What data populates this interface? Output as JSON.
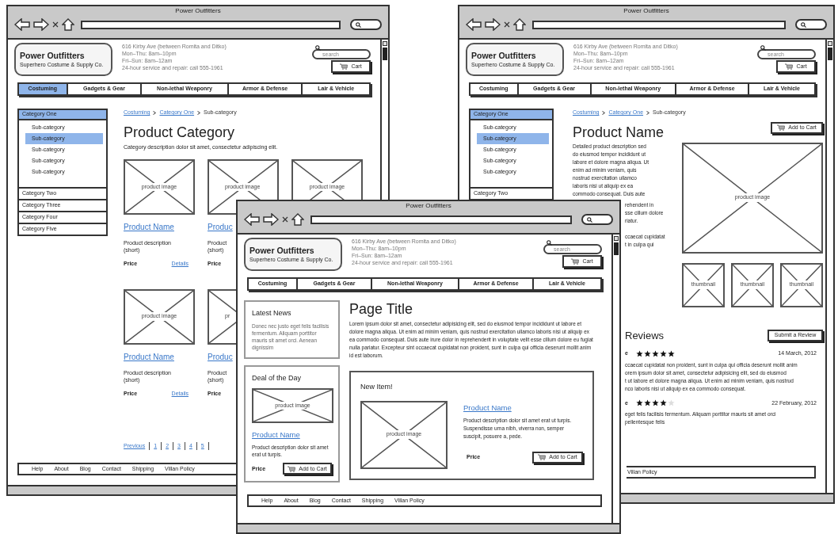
{
  "windows": [
    {
      "kind": "category",
      "title": "Power Outfitters",
      "header": {
        "logo_title": "Power Outfitters",
        "logo_subtitle": "Superhero Costume & Supply Co.",
        "address_lines": [
          "616 Kirby Ave (between Romita and Ditko)",
          "Mon–Thu: 8am–10pm",
          "Fri–Sun: 8am–12am",
          "24-hour service and repair: call 555-1961"
        ],
        "search_placeholder": "search",
        "cart": "Cart"
      },
      "nav": [
        {
          "label": "Costuming",
          "selected": true
        },
        {
          "label": "Gadgets & Gear",
          "selected": false
        },
        {
          "label": "Non-lethal Weaponry",
          "selected": false
        },
        {
          "label": "Armor & Defense",
          "selected": false
        },
        {
          "label": "Lair & Vehicle",
          "selected": false
        }
      ],
      "sidebar": [
        {
          "label": "Category One",
          "selected": true,
          "children": [
            {
              "label": "Sub-category",
              "selected": false
            },
            {
              "label": "Sub-category",
              "selected": true
            },
            {
              "label": "Sub-category",
              "selected": false
            },
            {
              "label": "Sub-category",
              "selected": false
            },
            {
              "label": "Sub-category",
              "selected": false
            }
          ]
        },
        {
          "label": "Category Two",
          "selected": false
        },
        {
          "label": "Category Three",
          "selected": false
        },
        {
          "label": "Category Four",
          "selected": false
        },
        {
          "label": "Category Five",
          "selected": false
        }
      ],
      "breadcrumb": [
        {
          "label": "Costuming",
          "link": true
        },
        {
          "label": "Category One",
          "link": true
        },
        {
          "label": "Sub-category",
          "link": false
        }
      ],
      "heading": "Product Category",
      "description": "Category description dolor sit amet, consectetur adipiscing elit.",
      "product_rows": [
        [
          {
            "kind": "full",
            "image_label": "product image",
            "name": "Product Name",
            "description_lines": [
              "Product description",
              "(short)"
            ],
            "price": "Price",
            "details": "Details"
          },
          {
            "kind": "cut",
            "image_label": "product image",
            "name": "Produc",
            "description_lines": [
              "Product",
              "(short)"
            ],
            "price": "Price"
          },
          {
            "kind": "full",
            "image_label": "product image"
          }
        ],
        [
          {
            "kind": "full",
            "image_label": "product image",
            "name": "Product Name",
            "description_lines": [
              "Product description",
              "(short)"
            ],
            "price": "Price",
            "details": "Details"
          },
          {
            "kind": "cut",
            "image_label": "pr",
            "name": "Produc",
            "description_lines": [
              "Product",
              "(short)"
            ],
            "price": "Price"
          }
        ]
      ],
      "pagination": {
        "previous": "Previous",
        "pages": [
          "1",
          "2",
          "3",
          "4",
          "5"
        ]
      },
      "footer": [
        "Help",
        "About",
        "Blog",
        "Contact",
        "Shipping",
        "Villan Policy"
      ]
    },
    {
      "kind": "product",
      "title": "Power Outfitters",
      "header": {
        "logo_title": "Power Outfitters",
        "logo_subtitle": "Superhero Costume & Supply Co.",
        "address_lines": [
          "616 Kirby Ave (between Romita and Ditko)",
          "Mon–Thu: 8am–10pm",
          "Fri–Sun: 8am–12am",
          "24-hour service and repair: call 555-1961"
        ],
        "search_placeholder": "search",
        "cart": "Cart"
      },
      "nav": [
        {
          "label": "Costuming",
          "selected": false
        },
        {
          "label": "Gadgets & Gear",
          "selected": false
        },
        {
          "label": "Non-lethal Weaponry",
          "selected": false
        },
        {
          "label": "Armor & Defense",
          "selected": false
        },
        {
          "label": "Lair & Vehicle",
          "selected": false
        }
      ],
      "sidebar": [
        {
          "label": "Category One",
          "selected": true,
          "children": [
            {
              "label": "Sub-category",
              "selected": false
            },
            {
              "label": "Sub-category",
              "selected": true
            },
            {
              "label": "Sub-category",
              "selected": false
            },
            {
              "label": "Sub-category",
              "selected": false
            },
            {
              "label": "Sub-category",
              "selected": false
            }
          ]
        },
        {
          "label": "Category Two",
          "selected": false
        }
      ],
      "breadcrumb": [
        {
          "label": "Costuming",
          "link": true
        },
        {
          "label": "Category One",
          "link": true
        },
        {
          "label": "Sub-category",
          "link": false
        }
      ],
      "heading": "Product Name",
      "add_to_cart": "Add to Cart",
      "description_lines": [
        "Detailed product description sed",
        "do eiusmod tempor incididunt ut",
        "labore et dolore magna aliqua. Ut",
        "enim ad minim veniam, quis",
        "nostrud exercitation ullamco",
        "laboris nisi ut aliquip ex ea",
        "commodo consequat. Duis aute"
      ],
      "description_tail_lines": [
        "rehendent in",
        "sse cillum dolore",
        "riatur."
      ],
      "description_tail_lines_2": [
        "ccaecat cupidatat",
        "t in culpa qui"
      ],
      "image_label": "product image",
      "thumbnails": [
        "thumbnail",
        "thumbnail",
        "thumbnail"
      ],
      "reviews": {
        "title": "Reviews",
        "button": "Submit a Review",
        "items": [
          {
            "author": "e",
            "stars": 5,
            "date": "14 March, 2012",
            "lines": [
              "ccaecat cupidatat non proident, sunt in culpa qui officia deserunt mollit anim",
              "orem ipsum dolor sit amet, consectetur adipisicing elit, sed do eiusmod",
              "t ut labore et dolore magna aliqua. Ut enim ad minim veniam, quis nostrud",
              "nco laboris nisi ut aliquip ex ea commodo consequat."
            ]
          },
          {
            "author": "e",
            "stars": 4,
            "date": "22 February, 2012",
            "lines": [
              "eget felis facilisis fermentum. Aliquam porttitor mauris sit amet orci",
              "pellentesque felis"
            ]
          }
        ]
      },
      "footer": [
        "Villan Policy"
      ]
    },
    {
      "kind": "home",
      "title": "Power Outfitters",
      "header": {
        "logo_title": "Power Outfitters",
        "logo_subtitle": "Superhero Costume & Supply Co.",
        "address_lines": [
          "616 Kirby Ave (between Romita and Ditko)",
          "Mon–Thu: 8am–10pm",
          "Fri–Sun: 8am–12am",
          "24-hour service and repair: call 555-1961"
        ],
        "search_placeholder": "search",
        "cart": "Cart"
      },
      "nav": [
        {
          "label": "Costuming",
          "selected": false
        },
        {
          "label": "Gadgets & Gear",
          "selected": false
        },
        {
          "label": "Non-lethal Weaponry",
          "selected": false
        },
        {
          "label": "Armor & Defense",
          "selected": false
        },
        {
          "label": "Lair & Vehicle",
          "selected": false
        }
      ],
      "news": {
        "title": "Latest News",
        "text": "Donec nec justo eget felis facilisis fermentum. Aliquam porttitor mauris sit amet orci. Aenean dignissim"
      },
      "deal": {
        "title": "Deal of the Day",
        "image_label": "product image",
        "name": "Product Name",
        "description": "Product description dolor sit amet erat ut turpis.",
        "price": "Price",
        "button": "Add to Cart"
      },
      "heading": "Page Title",
      "paragraph": "Lorem ipsum dolor sit amet, consectetur adipisicing elit, sed do eiusmod tempor incididunt ut labore et dolore magna aliqua. Ut enim ad minim veniam, quis nostrud exercitation ullamco laboris nisi ut aliquip ex ea commodo consequat. Duis aute irure dolor in reprehenderit in voluptate velit esse cillum dolore eu fugiat nulla pariatur. Excepteur sint occaecat cupidatat non proident, sunt in culpa qui officia deserunt mollit anim id est laborum.",
      "new_item": {
        "title": "New Item!",
        "image_label": "product image",
        "name": "Product Name",
        "description": "Product description dolor sit amet erat ut turpis. Suspendisse urna nibh, viverra non, semper suscipit, posuere a, pede.",
        "price": "Price",
        "button": "Add to Cart"
      },
      "footer": [
        "Help",
        "About",
        "Blog",
        "Contact",
        "Shipping",
        "Villan Policy"
      ]
    }
  ]
}
